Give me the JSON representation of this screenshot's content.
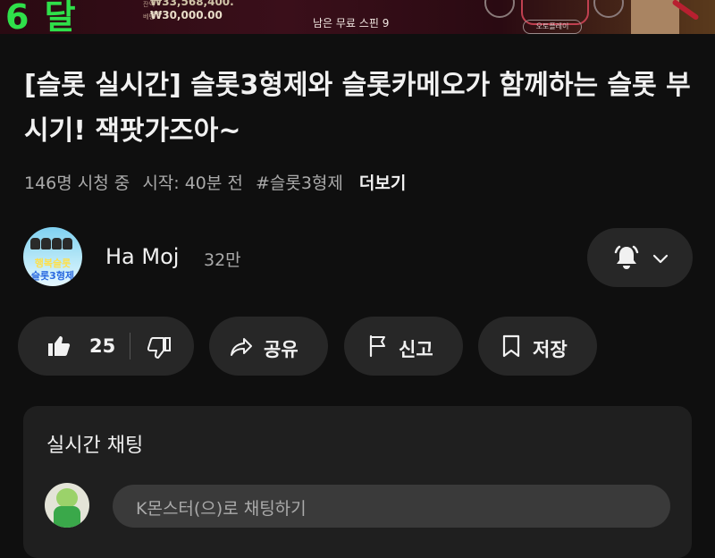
{
  "video": {
    "big_text": "6 달",
    "amount1": "₩33,568,400.",
    "amount2": "₩30,000.00",
    "label1": "잔액",
    "label2": "베팅",
    "spins_left": "남은 무료 스핀",
    "spins_count": "9",
    "auto_play": "오토플레이"
  },
  "title": "[슬롯 실시간] 슬롯3형제와 슬롯카메오가 함께하는 슬롯 부시기! 잭팟가즈아~",
  "meta": {
    "viewers": "146명 시청 중",
    "started": "시작: 40분 전",
    "hashtag": "#슬롯3형제",
    "more": "더보기"
  },
  "channel": {
    "name": "Ha Moj",
    "subscribers": "32만",
    "avatar_line1": "행복슬롯",
    "avatar_line2": "슬롯3형제"
  },
  "actions": {
    "like_count": "25",
    "share": "공유",
    "report": "신고",
    "save": "저장"
  },
  "chat": {
    "title": "실시간 채팅",
    "placeholder": "K몬스터(으)로 채팅하기"
  },
  "icons": {
    "bell": "bell-ringing-icon",
    "chevron": "chevron-down-icon",
    "like": "thumbs-up-icon",
    "dislike": "thumbs-down-icon",
    "share": "share-arrow-icon",
    "report": "flag-icon",
    "save": "bookmark-icon"
  }
}
